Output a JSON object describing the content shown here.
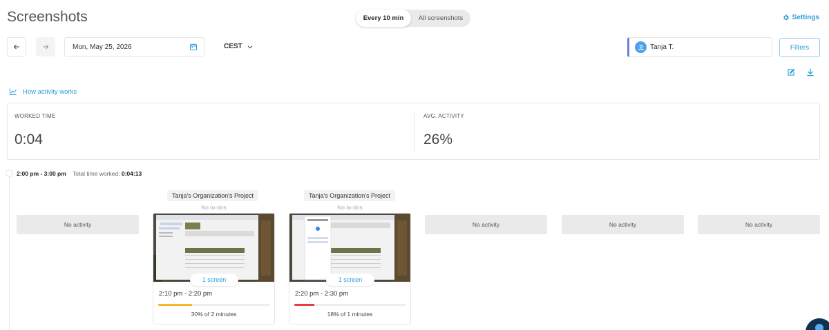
{
  "header": {
    "title": "Screenshots",
    "toggle": {
      "active": "Every 10 min",
      "inactive": "All screenshots"
    },
    "settings_label": "Settings"
  },
  "toolbar": {
    "date": "Mon, May 25, 2026",
    "timezone": "CEST",
    "user": "Tanja T.",
    "filters_label": "Filters"
  },
  "how_activity_link": "How activity works",
  "stats": {
    "worked_time_label": "WORKED TIME",
    "worked_time_value": "0:04",
    "avg_activity_label": "AVG. ACTIVITY",
    "avg_activity_value": "26%"
  },
  "timeline": {
    "hour_range": "2:00 pm - 3:00 pm",
    "total_label": "Total time worked:",
    "total_value": "0:04:13",
    "slots": [
      {
        "type": "empty",
        "label": "No activity"
      },
      {
        "type": "card",
        "project": "Tanja's Organization's Project",
        "todo": "No to-dos",
        "screens": "1 screen",
        "time": "2:10 pm - 2:20 pm",
        "activity_pct": 30,
        "activity_text": "30% of 2 minutes",
        "bar_color": "#f5b921"
      },
      {
        "type": "card",
        "project": "Tanja's Organization's Project",
        "todo": "No to-dos",
        "screens": "1 screen",
        "time": "2:20 pm - 2:30 pm",
        "activity_pct": 18,
        "activity_text": "18% of 1 minutes",
        "bar_color": "#e53e3e"
      },
      {
        "type": "empty",
        "label": "No activity"
      },
      {
        "type": "empty",
        "label": "No activity"
      },
      {
        "type": "empty",
        "label": "No activity"
      }
    ]
  },
  "colors": {
    "accent": "#2a9fd6",
    "user_border": "#6a7fd8"
  }
}
